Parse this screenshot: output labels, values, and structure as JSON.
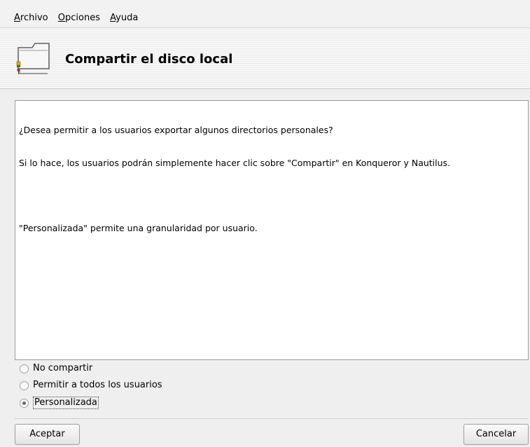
{
  "menubar": {
    "items": [
      {
        "accel": "A",
        "rest": "rchivo"
      },
      {
        "accel": "O",
        "rest": "pciones"
      },
      {
        "accel": "A",
        "rest": "yuda"
      }
    ]
  },
  "header": {
    "title": "Compartir el disco local",
    "icon": "folder-share-icon"
  },
  "message": {
    "line1": "¿Desea permitir a los usuarios exportar algunos directorios personales?",
    "line2": "Si lo hace, los usuarios podrán simplemente hacer clic sobre \"Compartir\" en Konqueror y Nautilus.",
    "line3": "\"Personalizada\" permite una granularidad por usuario."
  },
  "options": {
    "items": [
      {
        "label": "No compartir",
        "checked": false
      },
      {
        "label": "Permitir a todos los usuarios",
        "checked": false
      },
      {
        "label": "Personalizada",
        "checked": true
      }
    ]
  },
  "buttons": {
    "ok": "Aceptar",
    "cancel": "Cancelar"
  }
}
